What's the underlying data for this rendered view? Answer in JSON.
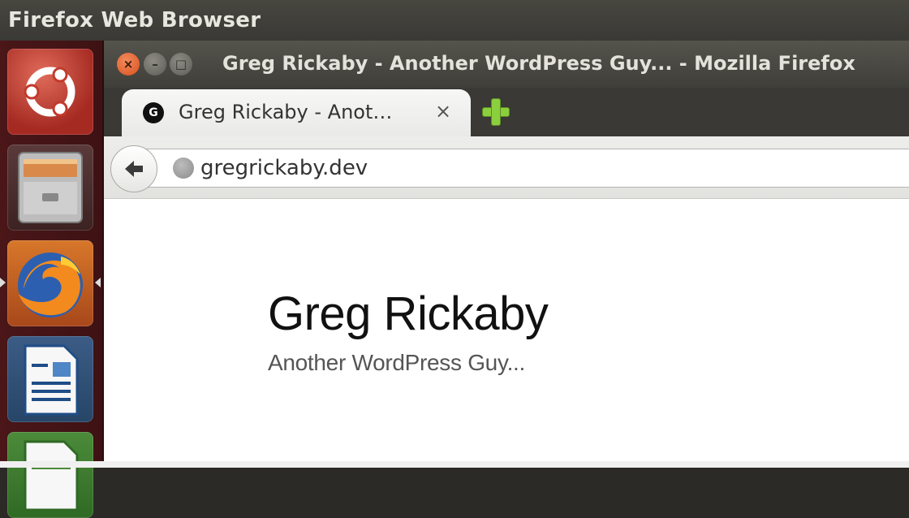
{
  "panel": {
    "app_name": "Firefox Web Browser"
  },
  "launcher": {
    "items": [
      {
        "name": "Ubuntu Dash",
        "icon": "ubuntu-logo-icon"
      },
      {
        "name": "Files",
        "icon": "file-cabinet-icon"
      },
      {
        "name": "Firefox",
        "icon": "firefox-icon",
        "active": true
      },
      {
        "name": "LibreOffice Writer",
        "icon": "writer-document-icon"
      },
      {
        "name": "LibreOffice Calc",
        "icon": "calc-spreadsheet-icon"
      }
    ]
  },
  "window": {
    "title": "Greg Rickaby - Another WordPress Guy... - Mozilla Firefox",
    "controls": {
      "close": "×",
      "minimize": "–",
      "maximize": "□"
    }
  },
  "tabs": [
    {
      "favicon_letter": "G",
      "label": "Greg Rickaby - Anot…",
      "close": "×"
    }
  ],
  "navbar": {
    "url": "gregrickaby.dev"
  },
  "page": {
    "site_title": "Greg Rickaby",
    "tagline": "Another WordPress Guy..."
  },
  "colors": {
    "launcher_bg": "#3e1214",
    "panel_bg": "#3a3935",
    "close_orange": "#d9501e",
    "newtab_green": "#8ccf3e"
  }
}
